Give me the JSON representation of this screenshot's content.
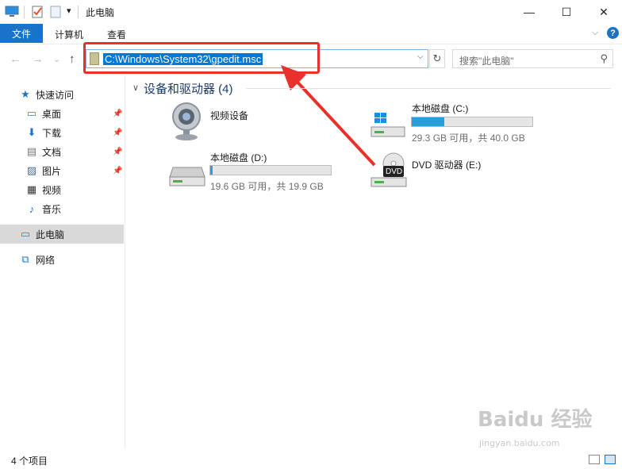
{
  "window": {
    "title": "此电脑",
    "minimize": "—",
    "maximize": "☐",
    "close": "✕"
  },
  "ribbon": {
    "file_tab": "文件",
    "tabs": [
      "计算机",
      "查看"
    ],
    "collapse_glyph": "⌵",
    "help_glyph": "?"
  },
  "nav": {
    "back": "←",
    "forward": "→",
    "recent": "⌄",
    "up": "↑"
  },
  "address": {
    "value": "C:\\Windows\\System32\\gpedit.msc",
    "dropdown": "⌵",
    "refresh": "↻"
  },
  "search": {
    "placeholder": "搜索\"此电脑\"",
    "icon": "⚲"
  },
  "sidebar": {
    "items": [
      {
        "label": "快速访问",
        "icon": "★",
        "icon_name": "star-icon",
        "color": "#1a73c8",
        "pinned": false
      },
      {
        "label": "桌面",
        "icon": "▭",
        "icon_name": "desktop-icon",
        "color": "#1a8fe0",
        "pinned": true
      },
      {
        "label": "下载",
        "icon": "⬇",
        "icon_name": "download-icon",
        "color": "#1a73c8",
        "pinned": true
      },
      {
        "label": "文档",
        "icon": "▤",
        "icon_name": "document-icon",
        "color": "#777777",
        "pinned": true
      },
      {
        "label": "图片",
        "icon": "▨",
        "icon_name": "picture-icon",
        "color": "#4a6a8a",
        "pinned": true
      },
      {
        "label": "视频",
        "icon": "▦",
        "icon_name": "video-icon",
        "color": "#333333",
        "pinned": false
      },
      {
        "label": "音乐",
        "icon": "♪",
        "icon_name": "music-icon",
        "color": "#1a73c8",
        "pinned": false
      },
      {
        "label": "此电脑",
        "icon": "▭",
        "icon_name": "computer-icon",
        "color": "#1a8fe0",
        "pinned": false
      },
      {
        "label": "网络",
        "icon": "⧉",
        "icon_name": "network-icon",
        "color": "#1a73c8",
        "pinned": false
      }
    ],
    "pin_glyph": "📌"
  },
  "main": {
    "group_title": "设备和驱动器 (4)",
    "group_chevron": "∨",
    "devices": [
      {
        "name": "视频设备",
        "type": "camera"
      },
      {
        "name": "本地磁盘 (C:)",
        "size": "29.3 GB 可用，共 40.0 GB",
        "used_fraction": 0.27,
        "type": "system-disk"
      },
      {
        "name": "本地磁盘 (D:)",
        "size": "19.6 GB 可用，共 19.9 GB",
        "used_fraction": 0.02,
        "type": "disk"
      },
      {
        "name": "DVD 驱动器 (E:)",
        "type": "dvd",
        "badge": "DVD"
      }
    ]
  },
  "status": {
    "count": "4 个项目"
  },
  "watermark": {
    "main": "Baidu 经验",
    "sub": "jingyan.baidu.com"
  }
}
